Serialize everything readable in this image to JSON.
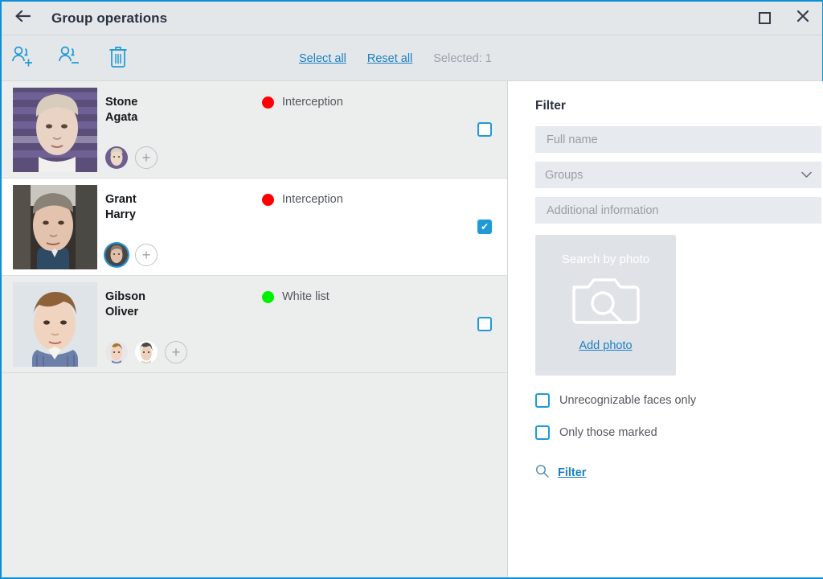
{
  "window": {
    "title": "Group operations",
    "back_icon": "arrow-left-icon",
    "maximize_icon": "maximize-icon",
    "close_icon": "close-icon",
    "accent_color": "#0e8fd2"
  },
  "toolbar": {
    "add_to_group_icon": "add-person-icon",
    "remove_from_group_icon": "remove-person-icon",
    "delete_icon": "trash-icon",
    "select_all_label": "Select all",
    "reset_all_label": "Reset all",
    "selected_label": "Selected: 1"
  },
  "people": [
    {
      "last_name": "Stone",
      "first_name": "Agata",
      "status": "Interception",
      "status_color": "#ff0000",
      "checked": false,
      "thumb_count": 1,
      "add_thumb_label": "+"
    },
    {
      "last_name": "Grant",
      "first_name": "Harry",
      "status": "Interception",
      "status_color": "#ff0000",
      "checked": true,
      "thumb_count": 1,
      "add_thumb_label": "+"
    },
    {
      "last_name": "Gibson",
      "first_name": "Oliver",
      "status": "White list",
      "status_color": "#00f000",
      "checked": false,
      "thumb_count": 2,
      "add_thumb_label": "+"
    }
  ],
  "filter": {
    "title": "Filter",
    "full_name_placeholder": "Full name",
    "full_name_value": "",
    "groups_label": "Groups",
    "groups_chevron_icon": "chevron-down-icon",
    "additional_info_placeholder": "Additional information",
    "additional_info_value": "",
    "photo_box_title": "Search by photo",
    "photo_box_icon": "camera-search-icon",
    "add_photo_label": "Add photo",
    "unrecognizable_label": "Unrecognizable faces only",
    "unrecognizable_checked": false,
    "only_marked_label": "Only those marked",
    "only_marked_checked": false,
    "filter_button_label": "Filter",
    "filter_button_icon": "search-icon"
  }
}
